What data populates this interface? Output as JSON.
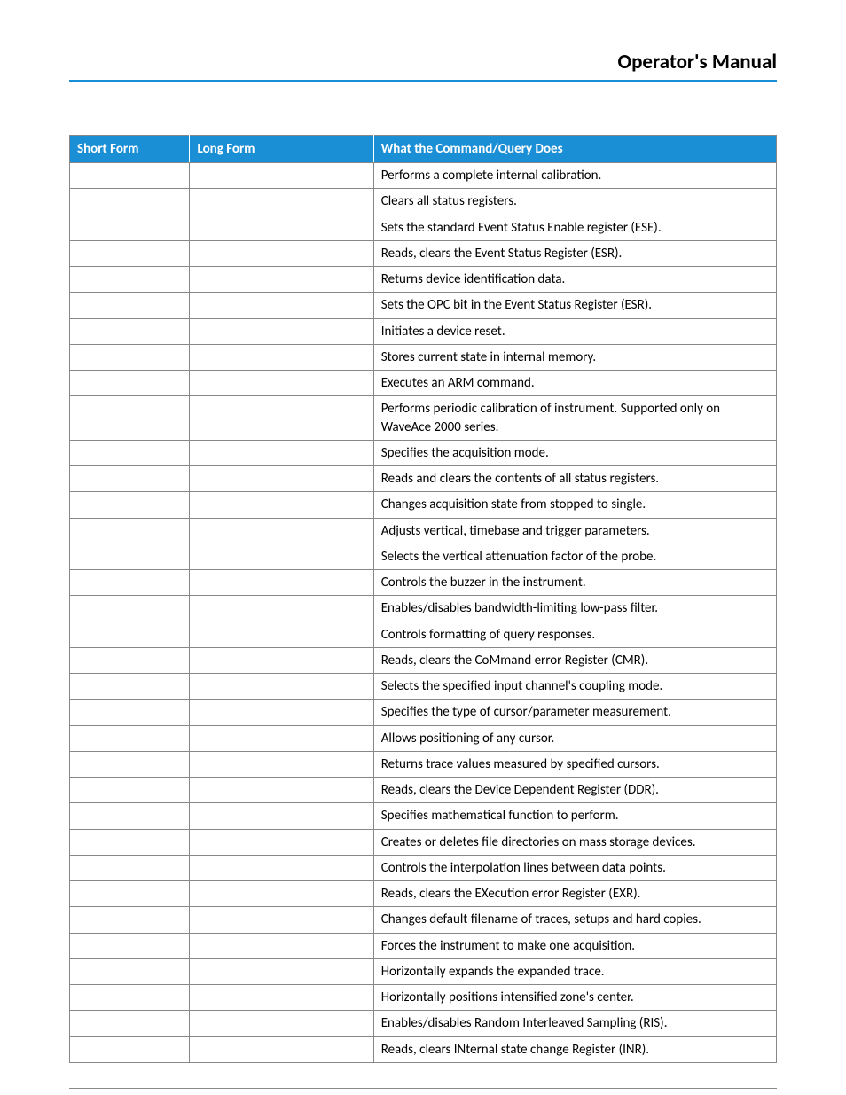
{
  "header": {
    "title": "Operator's Manual"
  },
  "table": {
    "columns": [
      "Short Form",
      "Long Form",
      "What the Command/Query Does"
    ],
    "rows": [
      {
        "short": "",
        "long": "",
        "desc": "Performs a complete internal calibration."
      },
      {
        "short": "",
        "long": "",
        "desc": "Clears all status registers."
      },
      {
        "short": "",
        "long": "",
        "desc": "Sets the standard Event Status Enable register (ESE)."
      },
      {
        "short": "",
        "long": "",
        "desc": "Reads, clears the Event Status Register (ESR)."
      },
      {
        "short": "",
        "long": "",
        "desc": "Returns device identification data."
      },
      {
        "short": "",
        "long": "",
        "desc": "Sets the OPC bit in the Event Status Register (ESR)."
      },
      {
        "short": "",
        "long": "",
        "desc": "Initiates a device reset."
      },
      {
        "short": "",
        "long": "",
        "desc": "Stores current state in internal memory."
      },
      {
        "short": "",
        "long": "",
        "desc": "Executes an ARM command."
      },
      {
        "short": "",
        "long": "",
        "desc": "Performs periodic calibration of instrument. Supported only on WaveAce 2000 series."
      },
      {
        "short": "",
        "long": "",
        "desc": "Specifies the acquisition mode."
      },
      {
        "short": "",
        "long": "",
        "desc": "Reads and clears the contents of all status registers."
      },
      {
        "short": "",
        "long": "",
        "desc": "Changes acquisition state from stopped to single."
      },
      {
        "short": "",
        "long": "",
        "desc": "Adjusts vertical, timebase and trigger parameters."
      },
      {
        "short": "",
        "long": "",
        "desc": "Selects the vertical attenuation factor of the probe."
      },
      {
        "short": "",
        "long": "",
        "desc": "Controls the buzzer in the instrument."
      },
      {
        "short": "",
        "long": "",
        "desc": "Enables/disables bandwidth-limiting low-pass filter."
      },
      {
        "short": "",
        "long": "",
        "desc": "Controls formatting of query responses."
      },
      {
        "short": "",
        "long": "",
        "desc": "Reads, clears the CoMmand error Register (CMR)."
      },
      {
        "short": "",
        "long": "",
        "desc": "Selects the specified input channel's coupling mode."
      },
      {
        "short": "",
        "long": "",
        "desc": "Specifies the type of cursor/parameter measurement."
      },
      {
        "short": "",
        "long": "",
        "desc": "Allows positioning of any cursor."
      },
      {
        "short": "",
        "long": "",
        "desc": "Returns trace values measured by specified cursors."
      },
      {
        "short": "",
        "long": "",
        "desc": "Reads, clears the Device Dependent Register (DDR)."
      },
      {
        "short": "",
        "long": "",
        "desc": "Specifies mathematical function to perform."
      },
      {
        "short": "",
        "long": "",
        "desc": "Creates or deletes file directories on mass storage devices."
      },
      {
        "short": "",
        "long": "",
        "desc": "Controls the interpolation lines between data points."
      },
      {
        "short": "",
        "long": "",
        "desc": "Reads, clears the EXecution error Register (EXR)."
      },
      {
        "short": "",
        "long": "",
        "desc": "Changes default filename of traces, setups and hard copies."
      },
      {
        "short": "",
        "long": "",
        "desc": "Forces the instrument to make one acquisition."
      },
      {
        "short": "",
        "long": "",
        "desc": "Horizontally expands the expanded trace."
      },
      {
        "short": "",
        "long": "",
        "desc": "Horizontally positions intensified zone's center."
      },
      {
        "short": "",
        "long": "",
        "desc": "Enables/disables Random Interleaved Sampling (RIS)."
      },
      {
        "short": "",
        "long": "",
        "desc": "Reads, clears INternal state change Register (INR)."
      }
    ]
  }
}
